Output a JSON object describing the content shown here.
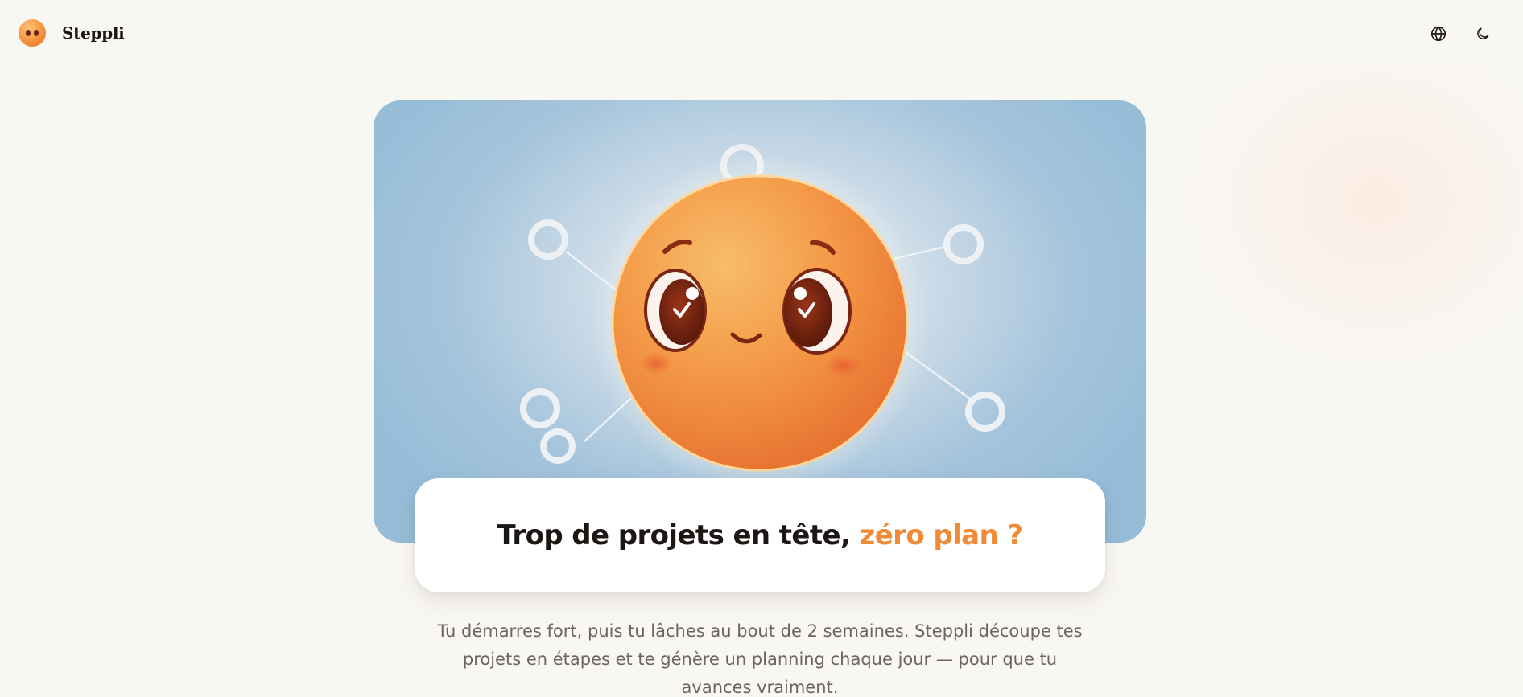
{
  "app": {
    "name": "Steppli"
  },
  "header": {
    "logo_icon": "smiling-orange-sun-icon",
    "language_icon": "globe-icon",
    "theme_icon": "moon-icon"
  },
  "hero": {
    "illustration": "orange-sun-mascot-with-checkmark-eyes-and-connected-nodes",
    "title_main": "Trop de projets en tête, ",
    "title_accent": "zéro plan ?"
  },
  "intro": {
    "text": "Tu démarres fort, puis tu lâches au bout de 2 semaines. Steppli découpe tes projets en étapes et te génère un planning chaque jour — pour que tu avances vraiment."
  },
  "colors": {
    "accent": "#f08a35",
    "background": "#f9f7f4",
    "hero_blue": "#96bcd8",
    "mascot_orange": "#f39240"
  }
}
